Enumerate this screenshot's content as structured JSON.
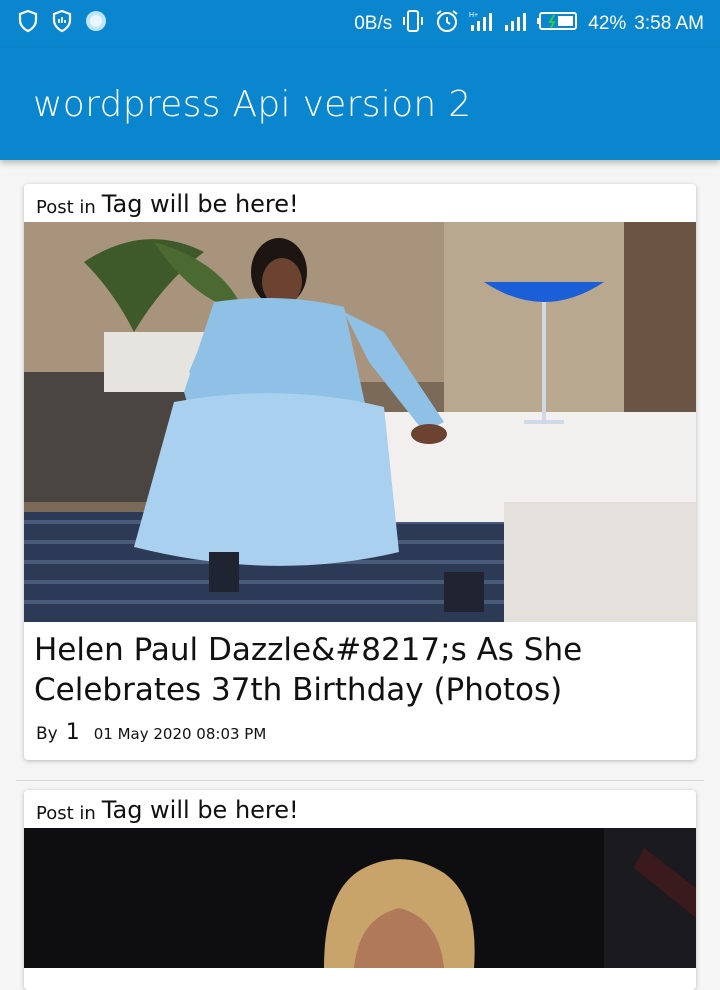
{
  "status_bar": {
    "network_speed": "0B/s",
    "battery_percent": "42%",
    "time": "3:58 AM",
    "icons": [
      "shield-icon",
      "shield-data-icon",
      "circle-app-icon",
      "vibrate-icon",
      "alarm-icon",
      "signal-h-plus-icon",
      "signal-icon",
      "battery-icon"
    ]
  },
  "app_bar": {
    "title": "wordpress Api version 2"
  },
  "posts": [
    {
      "post_in_label": "Post in",
      "tag": "Tag will be here!",
      "title": "Helen Paul Dazzle&#8217;s As She Celebrates 37th Birthday (Photos)",
      "by_label": "By",
      "author": "1",
      "date": "01 May 2020 08:03 PM"
    },
    {
      "post_in_label": "Post in",
      "tag": "Tag will be here!"
    }
  ],
  "colors": {
    "primary": "#0a86cf",
    "background": "#f5f5f5",
    "card": "#ffffff"
  }
}
